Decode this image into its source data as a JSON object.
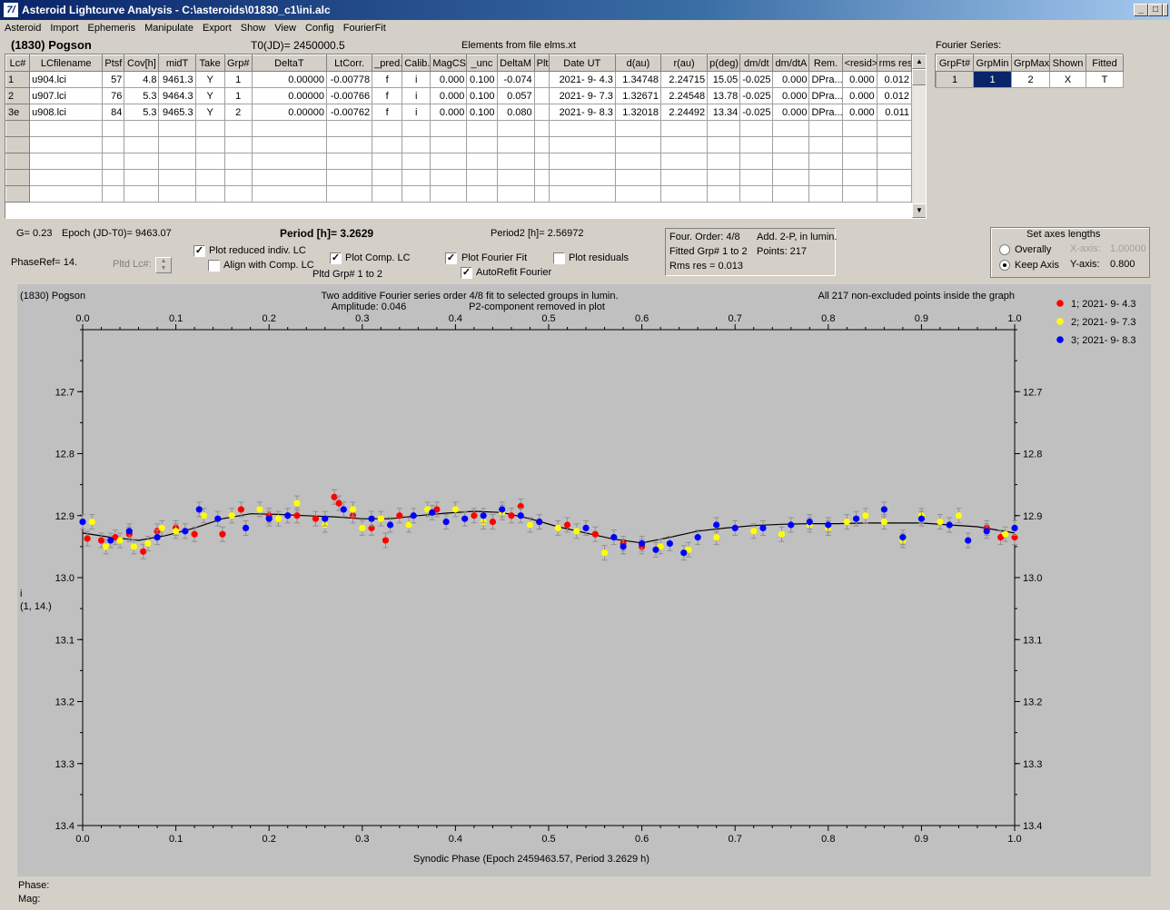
{
  "window": {
    "title": "Asteroid Lightcurve Analysis - C:\\asteroids\\01830_c1\\ini.alc",
    "icon_glyph": "7/"
  },
  "menu": [
    "Asteroid",
    "Import",
    "Ephemeris",
    "Manipulate",
    "Export",
    "Show",
    "View",
    "Config",
    "FourierFit"
  ],
  "header": {
    "asteroid": "(1830) Pogson",
    "t0": "T0(JD)= 2450000.5",
    "elements": "Elements from file elms.xt",
    "fourier_series_label": "Fourier Series:"
  },
  "lc_table": {
    "columns": [
      "Lc#",
      "LCfilename",
      "Ptsf",
      "Cov[h]",
      "midT",
      "Take",
      "Grp#",
      "DeltaT",
      "LtCorr.",
      "_pred.",
      "Calib.",
      "MagCS",
      "_unc",
      "DeltaM",
      "Plt",
      "Date UT",
      "d(au)",
      "r(au)",
      "p(deg)",
      "dm/dt",
      "dm/dtA",
      "Rem.",
      "<resid>",
      "rms res"
    ],
    "rows": [
      [
        "1",
        "u904.lci",
        "57",
        "4.8",
        "9461.3",
        "Y",
        "1",
        "0.00000",
        "-0.00778",
        "f",
        "i",
        "0.000",
        "0.100",
        "-0.074",
        "",
        "2021- 9- 4.3",
        "1.34748",
        "2.24715",
        "15.05",
        "-0.025",
        "0.000",
        "DPra...",
        "0.000",
        "0.012"
      ],
      [
        "2",
        "u907.lci",
        "76",
        "5.3",
        "9464.3",
        "Y",
        "1",
        "0.00000",
        "-0.00766",
        "f",
        "i",
        "0.000",
        "0.100",
        "0.057",
        "",
        "2021- 9- 7.3",
        "1.32671",
        "2.24548",
        "13.78",
        "-0.025",
        "0.000",
        "DPra...",
        "0.000",
        "0.012"
      ],
      [
        "3e",
        "u908.lci",
        "84",
        "5.3",
        "9465.3",
        "Y",
        "2",
        "0.00000",
        "-0.00762",
        "f",
        "i",
        "0.000",
        "0.100",
        "0.080",
        "",
        "2021- 9- 8.3",
        "1.32018",
        "2.24492",
        "13.34",
        "-0.025",
        "0.000",
        "DPra...",
        "0.000",
        "0.011"
      ]
    ],
    "empty_rows": 5
  },
  "fourier_table": {
    "columns": [
      "GrpFt#",
      "GrpMin",
      "GrpMax",
      "Shown",
      "Fitted"
    ],
    "row": [
      "1",
      "1",
      "2",
      "X",
      "T"
    ]
  },
  "params": {
    "g": "G= 0.23",
    "epoch": "Epoch (JD-T0)= 9463.07",
    "period": "Period [h]= 3.2629",
    "period2": "Period2 [h]= 2.56972",
    "phaseref": "PhaseRef= 14.",
    "pltd_lc": "Pltd Lc#:",
    "plot_reduced": "Plot reduced indiv. LC",
    "align_comp": "Align with Comp. LC",
    "plot_comp": "Plot Comp. LC",
    "pltd_grp": "Pltd Grp#  1   to   2",
    "plot_fourier": "Plot Fourier Fit",
    "autorefit": "AutoRefit Fourier",
    "plot_residuals": "Plot residuals",
    "checks": {
      "plot_reduced": true,
      "align_comp": false,
      "plot_comp": true,
      "plot_fourier": true,
      "autorefit": true,
      "plot_residuals": false
    }
  },
  "fit_info": {
    "order": "Four. Order:  4/8",
    "add": "Add. 2-P, in lumin.",
    "fitted": "Fitted Grp# 1 to 2",
    "points": "Points: 217",
    "rms": "Rms res     = 0.013"
  },
  "axes_box": {
    "title": "Set axes lengths",
    "overally": "Overally",
    "keep_axis": "Keep Axis",
    "xaxis_label": "X-axis:",
    "xaxis_value": "1.00000",
    "yaxis_label": "Y-axis:",
    "yaxis_value": "0.800",
    "selected": "keep_axis"
  },
  "plot_header": {
    "name": "(1830) Pogson",
    "line1": "Two additive Fourier series order 4/8 fit to selected groups in lumin.",
    "amplitude": "Amplitude: 0.046",
    "p2": "P2-component removed in plot",
    "points_note": "All 217 non-excluded points inside the graph"
  },
  "status": {
    "phase": "Phase:",
    "mag": "Mag:"
  },
  "colors": {
    "group1": "#ff0000",
    "group2": "#ffff00",
    "group3": "#0000ff",
    "plot_bg": "#c0c0c0",
    "selected_cell": "#0a246a"
  },
  "chart_data": {
    "type": "scatter",
    "xlabel": "Synodic Phase (Epoch 2459463.57, Period 3.2629 h)",
    "ylabel": "i",
    "ylabel2": "(1, 14.)",
    "xlim": [
      0.0,
      1.0
    ],
    "ylim": [
      13.4,
      12.6
    ],
    "x_ticks": [
      "0.0",
      "0.1",
      "0.2",
      "0.3",
      "0.4",
      "0.5",
      "0.6",
      "0.7",
      "0.8",
      "0.9",
      "1.0"
    ],
    "y_ticks": [
      "12.7",
      "12.8",
      "12.9",
      "13.0",
      "13.1",
      "13.2",
      "13.3",
      "13.4"
    ],
    "legend_position": "top-right",
    "legend": [
      "1; 2021- 9- 4.3",
      "2; 2021- 9- 7.3",
      "3; 2021- 9- 8.3"
    ],
    "fit_curve": {
      "x": [
        0.0,
        0.03,
        0.06,
        0.09,
        0.12,
        0.15,
        0.18,
        0.21,
        0.24,
        0.27,
        0.3,
        0.33,
        0.36,
        0.39,
        0.42,
        0.45,
        0.48,
        0.51,
        0.54,
        0.57,
        0.6,
        0.63,
        0.66,
        0.69,
        0.72,
        0.75,
        0.78,
        0.81,
        0.84,
        0.87,
        0.9,
        0.93,
        0.96,
        1.0
      ],
      "y": [
        12.928,
        12.935,
        12.94,
        12.932,
        12.92,
        12.905,
        12.897,
        12.898,
        12.9,
        12.902,
        12.905,
        12.905,
        12.9,
        12.896,
        12.893,
        12.895,
        12.905,
        12.918,
        12.928,
        12.938,
        12.944,
        12.935,
        12.925,
        12.92,
        12.916,
        12.914,
        12.913,
        12.913,
        12.912,
        12.912,
        12.912,
        12.915,
        12.918,
        12.928
      ]
    },
    "series": [
      {
        "name": "1; 2021- 9- 4.3",
        "x": [
          0.005,
          0.02,
          0.035,
          0.05,
          0.065,
          0.08,
          0.1,
          0.12,
          0.15,
          0.17,
          0.2,
          0.23,
          0.25,
          0.27,
          0.275,
          0.29,
          0.31,
          0.325,
          0.34,
          0.38,
          0.42,
          0.44,
          0.46,
          0.47,
          0.49,
          0.52,
          0.55,
          0.58,
          0.6,
          0.97,
          0.985,
          1.0
        ],
        "y": [
          12.937,
          12.94,
          12.935,
          12.93,
          12.958,
          12.925,
          12.92,
          12.93,
          12.93,
          12.89,
          12.9,
          12.9,
          12.905,
          12.87,
          12.88,
          12.9,
          12.92,
          12.94,
          12.9,
          12.89,
          12.9,
          12.91,
          12.9,
          12.885,
          12.91,
          12.915,
          12.93,
          12.945,
          12.95,
          12.92,
          12.935,
          12.935
        ]
      },
      {
        "name": "2; 2021- 9- 7.3",
        "x": [
          0.01,
          0.025,
          0.04,
          0.055,
          0.07,
          0.085,
          0.1,
          0.13,
          0.16,
          0.19,
          0.21,
          0.23,
          0.26,
          0.29,
          0.3,
          0.32,
          0.35,
          0.37,
          0.4,
          0.43,
          0.45,
          0.48,
          0.51,
          0.53,
          0.56,
          0.58,
          0.62,
          0.65,
          0.68,
          0.72,
          0.75,
          0.78,
          0.8,
          0.82,
          0.84,
          0.86,
          0.88,
          0.9,
          0.92,
          0.94,
          0.99
        ],
        "y": [
          12.91,
          12.95,
          12.94,
          12.95,
          12.945,
          12.92,
          12.925,
          12.9,
          12.9,
          12.89,
          12.905,
          12.88,
          12.915,
          12.89,
          12.92,
          12.905,
          12.915,
          12.89,
          12.89,
          12.91,
          12.895,
          12.915,
          12.92,
          12.925,
          12.96,
          12.95,
          12.95,
          12.955,
          12.935,
          12.925,
          12.93,
          12.915,
          12.92,
          12.91,
          12.9,
          12.91,
          12.94,
          12.9,
          12.91,
          12.9,
          12.93
        ]
      },
      {
        "name": "3; 2021- 9- 8.3",
        "x": [
          0.0,
          0.03,
          0.05,
          0.08,
          0.11,
          0.125,
          0.145,
          0.175,
          0.2,
          0.22,
          0.26,
          0.28,
          0.31,
          0.33,
          0.355,
          0.375,
          0.39,
          0.41,
          0.43,
          0.45,
          0.47,
          0.49,
          0.54,
          0.57,
          0.58,
          0.6,
          0.615,
          0.63,
          0.645,
          0.66,
          0.68,
          0.7,
          0.73,
          0.76,
          0.78,
          0.8,
          0.83,
          0.86,
          0.88,
          0.9,
          0.93,
          0.95,
          0.97,
          1.0
        ],
        "y": [
          12.91,
          12.94,
          12.925,
          12.935,
          12.925,
          12.89,
          12.905,
          12.92,
          12.905,
          12.9,
          12.905,
          12.89,
          12.905,
          12.915,
          12.9,
          12.895,
          12.91,
          12.905,
          12.9,
          12.89,
          12.9,
          12.91,
          12.92,
          12.935,
          12.95,
          12.945,
          12.955,
          12.945,
          12.96,
          12.935,
          12.915,
          12.92,
          12.92,
          12.915,
          12.91,
          12.915,
          12.905,
          12.89,
          12.935,
          12.905,
          12.915,
          12.94,
          12.925,
          12.92
        ]
      }
    ]
  }
}
